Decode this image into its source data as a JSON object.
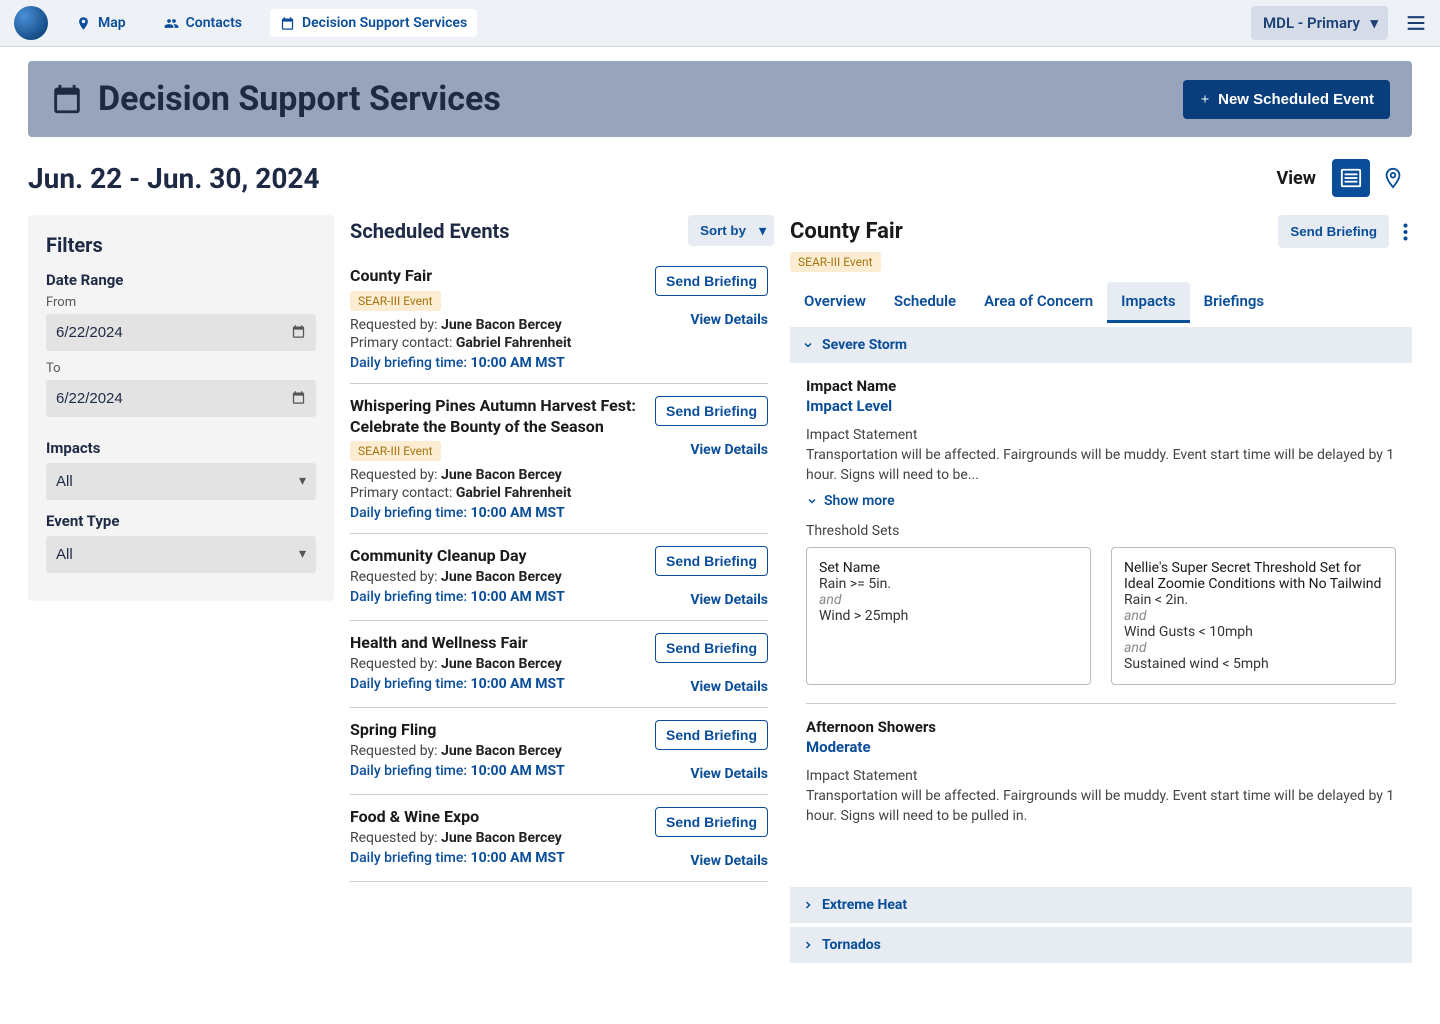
{
  "nav": {
    "items": [
      {
        "label": "Map",
        "icon": "pin"
      },
      {
        "label": "Contacts",
        "icon": "people"
      },
      {
        "label": "Decision Support Services",
        "icon": "calendar"
      }
    ],
    "org_selected": "MDL - Primary"
  },
  "banner": {
    "title": "Decision Support Services",
    "new_event_btn": "New Scheduled Event"
  },
  "date_range_text": "Jun. 22 - Jun. 30, 2024",
  "view_label": "View",
  "filters": {
    "title": "Filters",
    "date_range_label": "Date Range",
    "from_label": "From",
    "from_value": "6/22/2024",
    "to_label": "To",
    "to_value": "6/22/2024",
    "impacts_label": "Impacts",
    "impacts_value": "All",
    "event_type_label": "Event Type",
    "event_type_value": "All"
  },
  "events": {
    "title": "Scheduled Events",
    "sort_btn": "Sort by",
    "send_briefing_label": "Send Briefing",
    "view_details_label": "View Details",
    "requested_by_label": "Requested by:",
    "primary_contact_label": "Primary contact:",
    "briefing_time_label": "Daily briefing time:",
    "list": [
      {
        "name": "County Fair",
        "badge": "SEAR-III Event",
        "requester": "June Bacon Bercey",
        "primary_contact": "Gabriel Fahrenheit",
        "briefing_time": "10:00 AM MST"
      },
      {
        "name": "Whispering Pines Autumn Harvest Fest: Celebrate the Bounty of the Season",
        "badge": "SEAR-III Event",
        "requester": "June Bacon Bercey",
        "primary_contact": "Gabriel Fahrenheit",
        "briefing_time": "10:00 AM MST"
      },
      {
        "name": "Community Cleanup Day",
        "requester": "June Bacon Bercey",
        "briefing_time": "10:00 AM MST"
      },
      {
        "name": "Health and Wellness Fair",
        "requester": "June Bacon Bercey",
        "briefing_time": "10:00 AM MST"
      },
      {
        "name": "Spring Fling",
        "requester": "June Bacon Bercey",
        "briefing_time": "10:00 AM MST"
      },
      {
        "name": "Food & Wine Expo",
        "requester": "June Bacon Bercey",
        "briefing_time": "10:00 AM MST"
      }
    ]
  },
  "detail": {
    "title": "County Fair",
    "badge": "SEAR-III Event",
    "send_briefing_btn": "Send Briefing",
    "tabs": [
      "Overview",
      "Schedule",
      "Area of Concern",
      "Impacts",
      "Briefings"
    ],
    "active_tab": 3,
    "accordions": {
      "open": {
        "title": "Severe Storm",
        "impacts": [
          {
            "name": "Impact Name",
            "level": "Impact Level",
            "statement_label": "Impact Statement",
            "statement": "Transportation will be affected. Fairgrounds will be muddy. Event start time will be delayed by 1 hour. Signs will need to be...",
            "show_more": "Show more",
            "threshold_label": "Threshold Sets",
            "thresholds": [
              {
                "name": "Set Name",
                "lines": [
                  "Rain >= 5in.",
                  "and",
                  "Wind > 25mph"
                ]
              },
              {
                "name": "Nellie's Super Secret Threshold Set for Ideal Zoomie Conditions with No Tailwind",
                "lines": [
                  "Rain < 2in.",
                  "and",
                  "Wind Gusts < 10mph",
                  "and",
                  "Sustained wind < 5mph"
                ]
              }
            ]
          },
          {
            "name": "Afternoon Showers",
            "level": "Moderate",
            "statement_label": "Impact Statement",
            "statement": "Transportation will be affected. Fairgrounds will be muddy. Event start time will be delayed by 1 hour. Signs will need to be pulled in."
          }
        ]
      },
      "collapsed": [
        "Extreme Heat",
        "Tornados"
      ]
    }
  }
}
